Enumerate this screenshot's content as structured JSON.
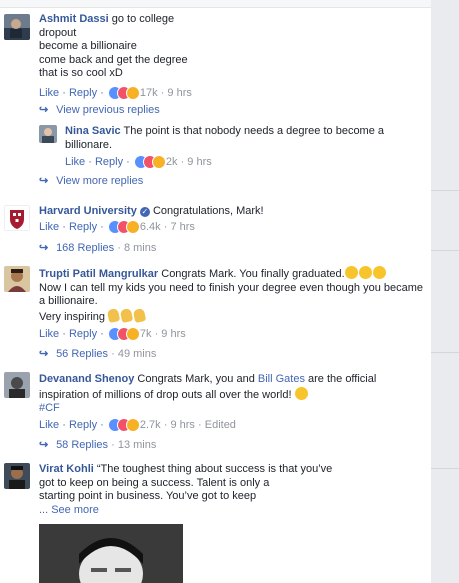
{
  "reaction_labels": {
    "like": "like-reaction-icon",
    "love": "love-reaction-icon",
    "haha": "haha-reaction-icon"
  },
  "comments": [
    {
      "author": "Ashmit Dassi",
      "lines": [
        "go to college",
        "dropout",
        "become a billionaire",
        "come back and get the degree",
        "that is so cool xD"
      ],
      "like": "Like",
      "reply": "Reply",
      "reactions": "17k",
      "time": "9 hrs",
      "view_previous": "View previous replies"
    },
    {
      "author": "Nina Savic",
      "lines": [
        "The point is that nobody needs a degree to become a",
        "billionare."
      ],
      "like": "Like",
      "reply": "Reply",
      "reactions": "2k",
      "time": "9 hrs",
      "view_more": "View more replies"
    },
    {
      "author": "Harvard University",
      "text": "Congratulations, Mark!",
      "like": "Like",
      "reply": "Reply",
      "reactions": "6.4k",
      "time": "7 hrs",
      "replies": "168 Replies",
      "replies_time": "8 mins"
    },
    {
      "author": "Trupti Patil Mangrulkar",
      "lines": [
        "Congrats Mark. You finally graduated.",
        "Now I can tell my kids you need to finish your degree even though you became",
        "a billionaire.",
        "Very inspiring"
      ],
      "like": "Like",
      "reply": "Reply",
      "reactions": "7k",
      "time": "9 hrs",
      "replies": "56 Replies",
      "replies_time": "49 mins"
    },
    {
      "author": "Devanand Shenoy",
      "text_a": "Congrats Mark, you and",
      "mention": "Bill Gates",
      "text_b": "are the official",
      "line2": "inspiration of millions of drop outs all over the world!",
      "hashtag": "#CF",
      "like": "Like",
      "reply": "Reply",
      "reactions": "2.7k",
      "time": "9 hrs",
      "edited": "Edited",
      "replies": "58 Replies",
      "replies_time": "13 mins"
    },
    {
      "author": "Virat Kohli",
      "lines": [
        "“The toughest thing about success is that you’ve",
        "got to keep on being a success. Talent is only a",
        "starting point in business. You’ve got to keep"
      ],
      "see_more": "... See more"
    }
  ]
}
